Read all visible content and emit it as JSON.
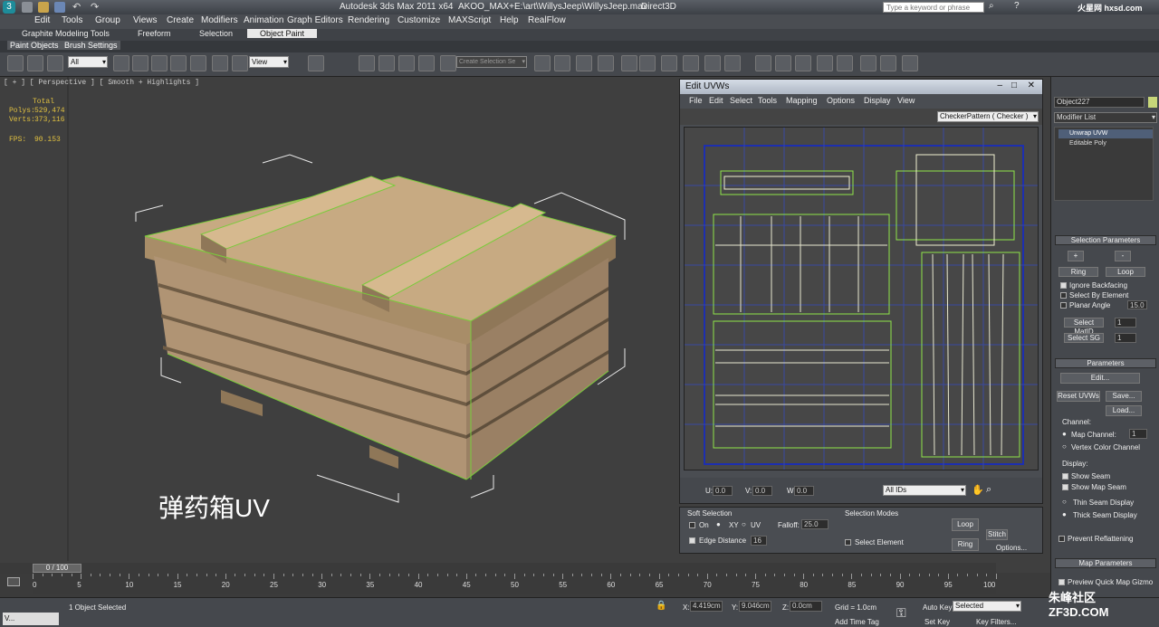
{
  "app": {
    "title": "Autodesk 3ds Max  2011 x64",
    "project": "AKOO_MAX+",
    "file": "E:\\art\\WillysJeep\\WillysJeep.max",
    "renderer": "Direct3D",
    "search_placeholder": "Type a keyword or phrase",
    "watermark_top": "火星网 hxsd.com",
    "watermark_bottom": "朱峰社区 ZF3D.COM"
  },
  "menu": [
    "Edit",
    "Tools",
    "Group",
    "Views",
    "Create",
    "Modifiers",
    "Animation",
    "Graph Editors",
    "Rendering",
    "Customize",
    "MAXScript",
    "Help",
    "RealFlow"
  ],
  "ribbon": {
    "tabs": [
      "Graphite Modeling Tools",
      "Freeform",
      "Selection",
      "Object Paint"
    ],
    "active_tab": "Object Paint",
    "sub": [
      "Paint Objects",
      "Brush Settings"
    ]
  },
  "toolbar": {
    "filter": "All",
    "view": "View",
    "selection_set": "Create Selection Se"
  },
  "viewport": {
    "label": "[ + ] [ Perspective ] [ Smooth + Highlights ]",
    "stats_title": "Total",
    "polys_label": "Polys:",
    "polys": "529,474",
    "verts_label": "Verts:",
    "verts": "373,116",
    "fps_label": "FPS:",
    "fps": "90.153",
    "caption": "弹药箱UV"
  },
  "uvw": {
    "title": "Edit UVWs",
    "menu": [
      "File",
      "Edit",
      "Select",
      "Tools",
      "Mapping",
      "Options",
      "Display",
      "View"
    ],
    "texture": "CheckerPattern  ( Checker )",
    "u_label": "U:",
    "u": "0.0",
    "v_label": "V:",
    "v": "0.0",
    "w_label": "W:",
    "w": "0.0",
    "ids": "All IDs",
    "soft_selection": "Soft Selection",
    "on": "On",
    "xy": "XY",
    "uv": "UV",
    "falloff_label": "Falloff:",
    "falloff": "25.0",
    "edge_distance": "Edge Distance",
    "edge_value": "16",
    "selection_modes": "Selection Modes",
    "select_element": "Select Element",
    "loop": "Loop",
    "ring": "Ring",
    "stitch": "Stitch",
    "options": "Options..."
  },
  "command_panel": {
    "object_name": "Object227",
    "modifier_list": "Modifier List",
    "stack": [
      "Unwrap UVW",
      "Editable Poly"
    ],
    "selection_parameters": "Selection Parameters",
    "plus": "+",
    "minus": "-",
    "ring": "Ring",
    "loop": "Loop",
    "ignore_backfacing": "Ignore Backfacing",
    "select_by_element": "Select By Element",
    "planar_angle": "Planar Angle",
    "planar_value": "15.0",
    "select_matid": "Select MatID",
    "select_sg": "Select SG",
    "spinner_1": "1",
    "parameters": "Parameters",
    "edit": "Edit...",
    "reset_uvws": "Reset UVWs",
    "save": "Save...",
    "load": "Load...",
    "channel": "Channel:",
    "map_channel": "Map Channel:",
    "map_channel_value": "1",
    "vertex_color_channel": "Vertex Color Channel",
    "display": "Display:",
    "show_seam": "Show Seam",
    "show_map_seam": "Show Map Seam",
    "thin_seam": "Thin Seam Display",
    "thick_seam": "Thick Seam Display",
    "prevent_reflattening": "Prevent Reflattening",
    "map_parameters": "Map Parameters",
    "preview_quick_map": "Preview Quick Map Gizmo"
  },
  "timeline": {
    "frame": "0 / 100",
    "ticks": [
      "0",
      "5",
      "10",
      "15",
      "20",
      "25",
      "30",
      "35",
      "40",
      "45",
      "50",
      "55",
      "60",
      "65",
      "70",
      "75",
      "80",
      "85",
      "90",
      "95",
      "100"
    ]
  },
  "status": {
    "selected": "1 Object Selected",
    "x_label": "X:",
    "x": "4.419cm",
    "y_label": "Y:",
    "y": "9.046cm",
    "z_label": "Z:",
    "z": "0.0cm",
    "grid": "Grid = 1.0cm",
    "auto_key": "Auto Key",
    "set_key": "Set Key",
    "key_mode": "Selected",
    "key_filters": "Key Filters...",
    "add_time_tag": "Add Time Tag"
  }
}
